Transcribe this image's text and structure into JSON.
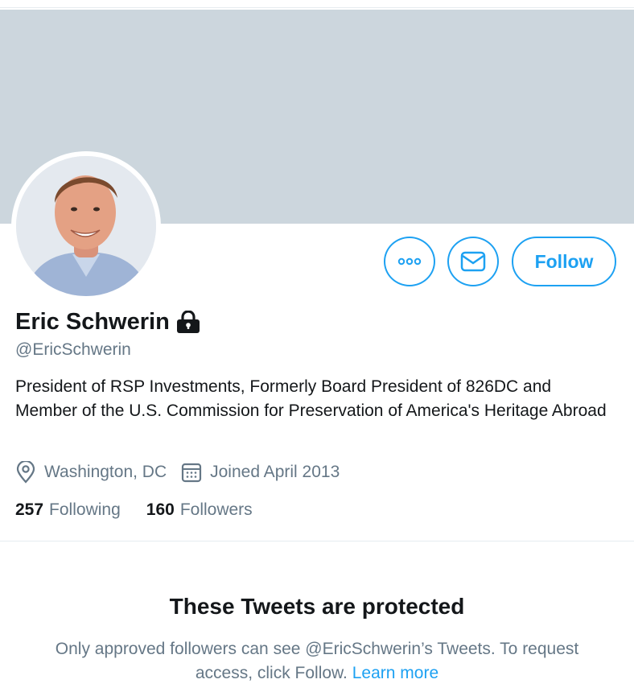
{
  "colors": {
    "accent": "#1da1f2",
    "banner": "#ccd6dd",
    "secondary_text": "#657786",
    "primary_text": "#14171a"
  },
  "profile": {
    "name": "Eric Schwerin",
    "handle": "@EricSchwerin",
    "bio": "President of RSP Investments, Formerly Board President of 826DC and Member of the U.S. Commission for Preservation of America's Heritage Abroad",
    "location": "Washington, DC",
    "joined": "Joined April 2013",
    "protected_icon": "lock-icon",
    "location_icon": "location-pin-icon",
    "joined_icon": "calendar-icon"
  },
  "actions": {
    "more_icon": "more-icon",
    "message_icon": "envelope-icon",
    "follow_label": "Follow"
  },
  "stats": {
    "following_count": "257",
    "following_label": "Following",
    "followers_count": "160",
    "followers_label": "Followers"
  },
  "protected_notice": {
    "title": "These Tweets are protected",
    "text": "Only approved followers can see @EricSchwerin’s Tweets. To request access, click Follow.",
    "link": "Learn more"
  }
}
